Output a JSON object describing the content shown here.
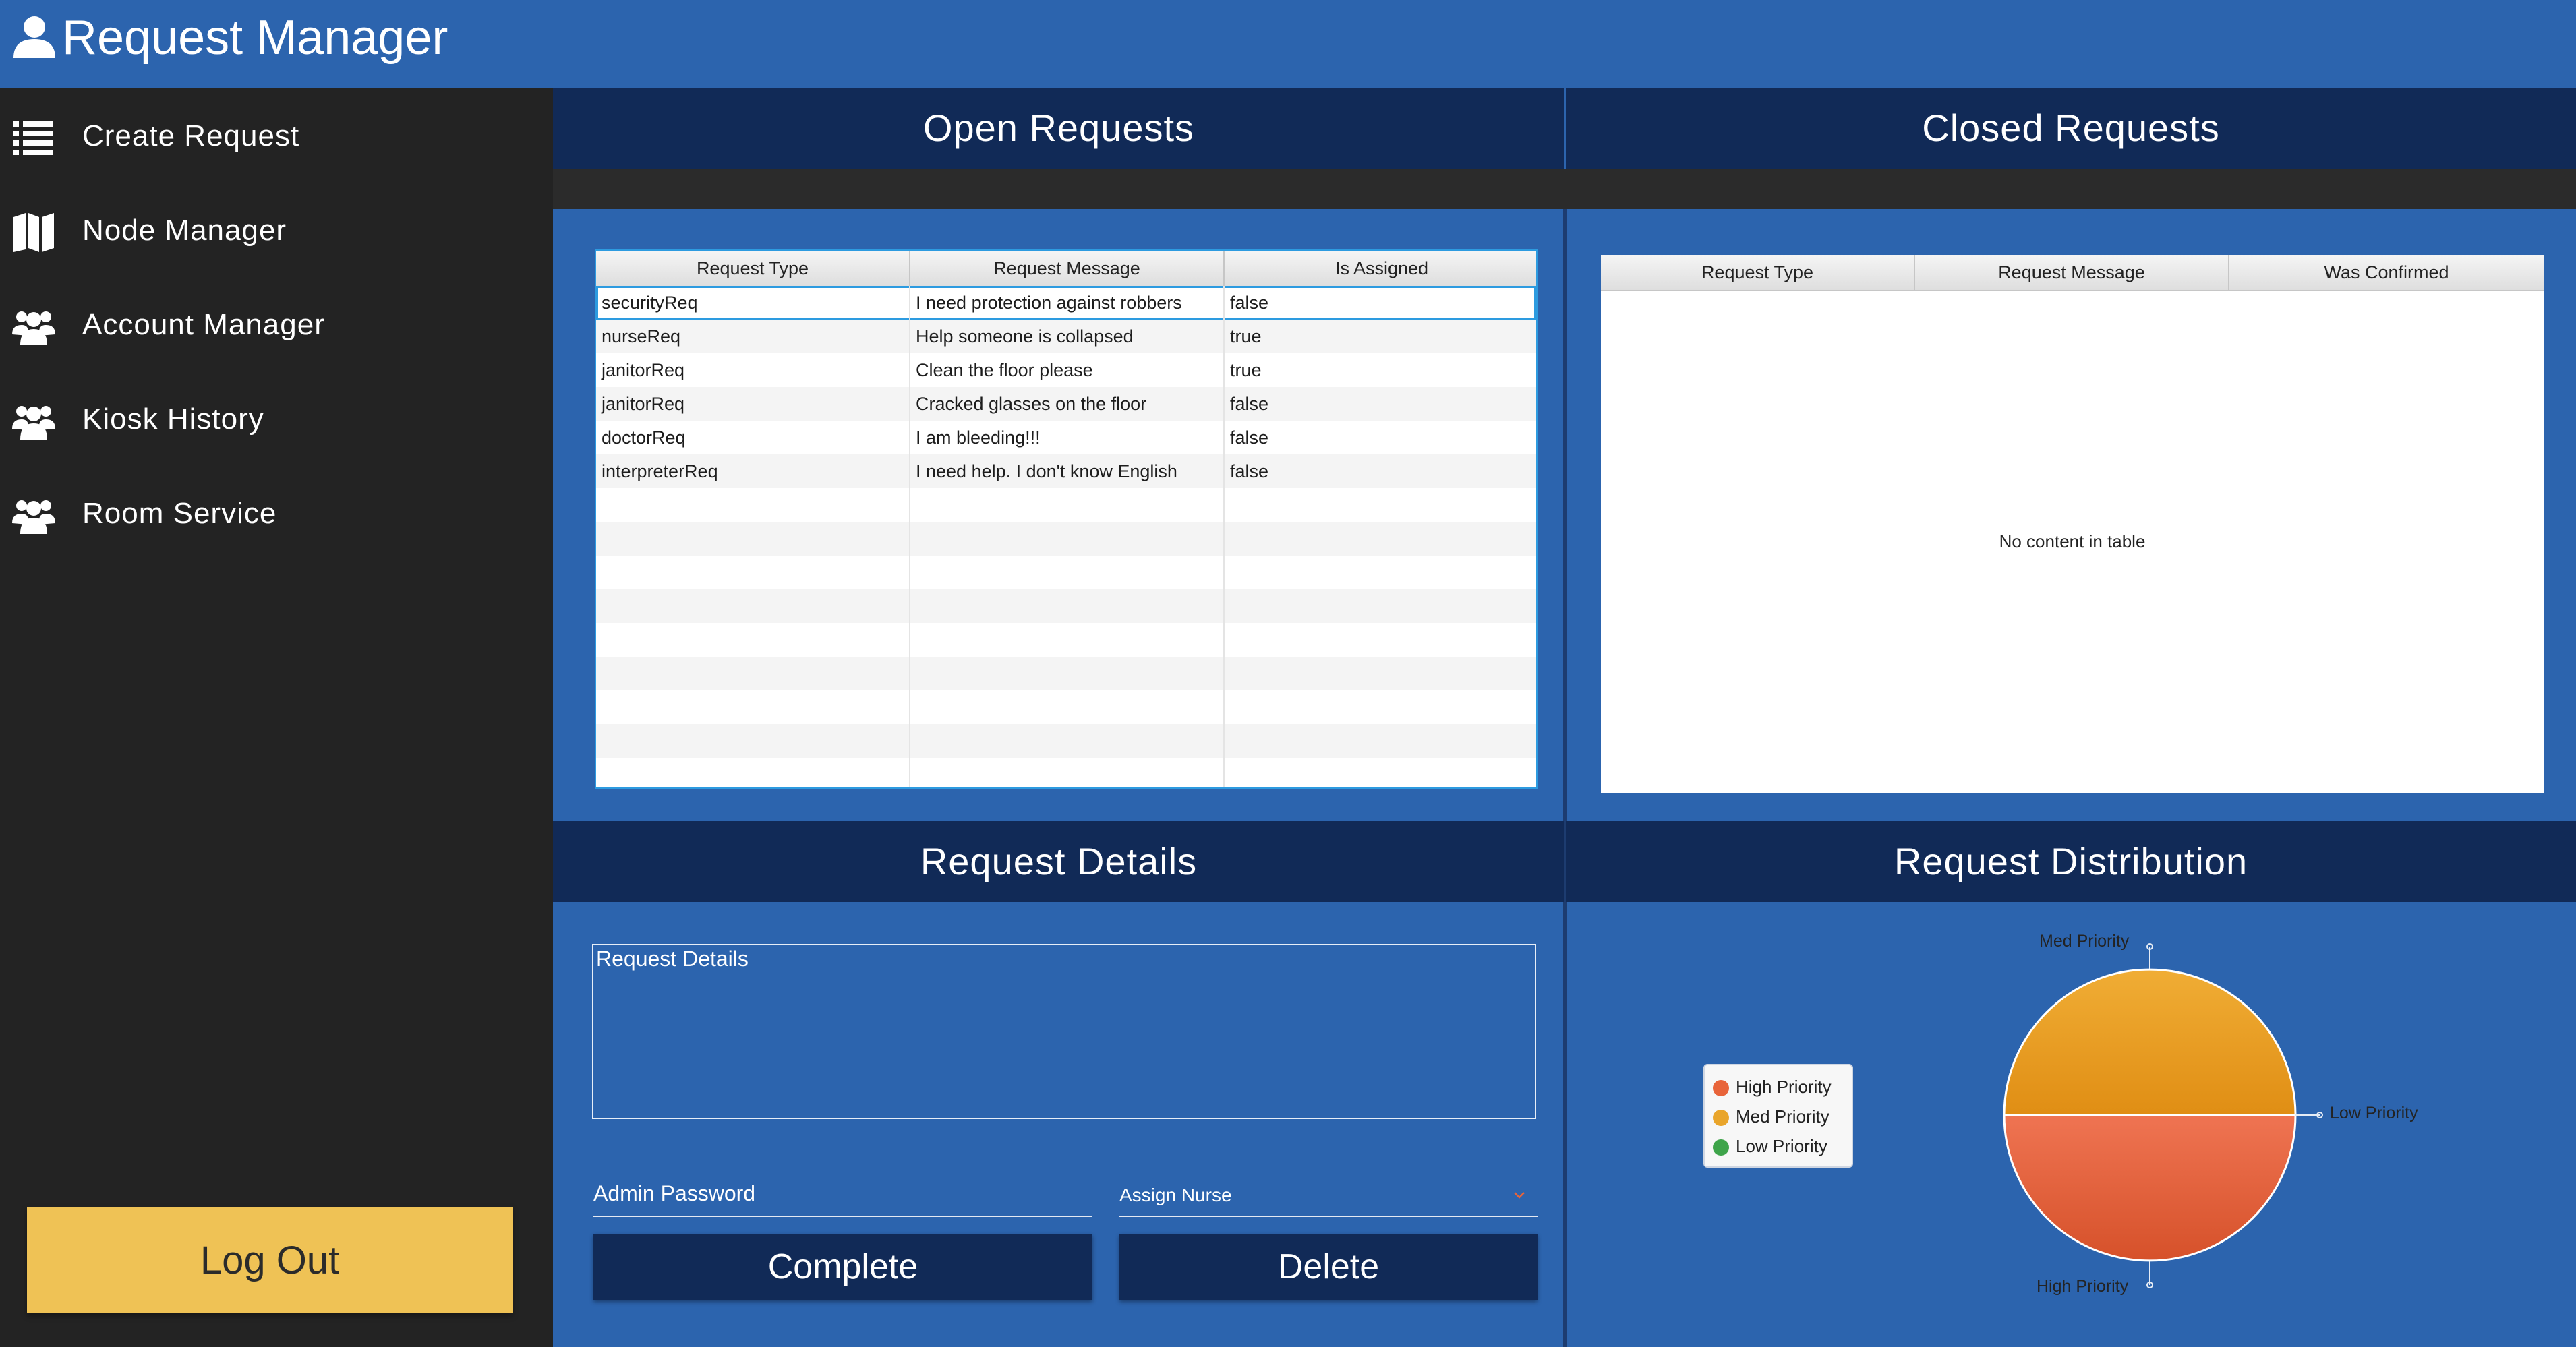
{
  "app": {
    "title": "Request Manager"
  },
  "sidebar": {
    "items": [
      {
        "label": "Create Request",
        "icon": "list-icon"
      },
      {
        "label": "Node Manager",
        "icon": "map-icon"
      },
      {
        "label": "Account Manager",
        "icon": "users-icon"
      },
      {
        "label": "Kiosk History",
        "icon": "users-icon"
      },
      {
        "label": "Room Service",
        "icon": "users-icon"
      }
    ],
    "logout_label": "Log Out"
  },
  "open_requests": {
    "title": "Open Requests",
    "columns": [
      "Request Type",
      "Request Message",
      "Is Assigned"
    ],
    "rows": [
      [
        "securityReq",
        "I need protection against robbers",
        "false"
      ],
      [
        "nurseReq",
        "Help someone is collapsed",
        "true"
      ],
      [
        "janitorReq",
        "Clean the floor please",
        "true"
      ],
      [
        "janitorReq",
        "Cracked glasses on the floor",
        "false"
      ],
      [
        "doctorReq",
        "I am bleeding!!!",
        "false"
      ],
      [
        "interpreterReq",
        "I need help. I don't know English",
        "false"
      ]
    ]
  },
  "closed_requests": {
    "title": "Closed Requests",
    "columns": [
      "Request Type",
      "Request Message",
      "Was Confirmed"
    ],
    "empty_text": "No content in table"
  },
  "request_details": {
    "title": "Request Details",
    "textarea_placeholder": "Request Details",
    "password_placeholder": "Admin Password",
    "assign_placeholder": "Assign Nurse",
    "complete_label": "Complete",
    "delete_label": "Delete"
  },
  "distribution": {
    "title": "Request Distribution"
  },
  "chart_data": {
    "type": "pie",
    "legend_position": "left",
    "slices": [
      {
        "name": "High Priority",
        "value": 1,
        "color": "#e8643a"
      },
      {
        "name": "Med Priority",
        "value": 1,
        "color": "#e9a52b"
      },
      {
        "name": "Low Priority",
        "value": 0,
        "color": "#3ea44a"
      }
    ],
    "labels": [
      "Med Priority",
      "Low Priority",
      "High Priority"
    ]
  }
}
